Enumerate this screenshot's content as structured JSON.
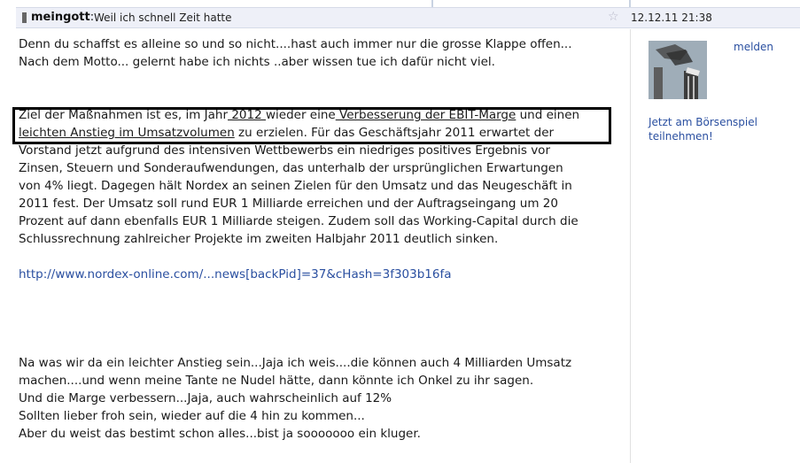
{
  "post": {
    "author": "meingott",
    "subject_sep": ":",
    "subject": "Weil ich schnell Zeit hatte",
    "timestamp": "12.12.11 21:38",
    "lines_intro": [
      "Denn du schaffst es alleine so und so nicht....hast auch immer nur die grosse Klappe offen...",
      "Nach dem Motto... gelernt habe ich nichts ..aber wissen tue ich dafür nicht viel."
    ],
    "quote": {
      "l1_a": "Ziel der Maßnahmen ist es, im Jahr",
      "l1_b": " 2012 ",
      "l1_c": "wieder eine",
      "l1_d": " Verbesserung der EBIT-Marge",
      "l1_e": " und einen",
      "l2_a": "leichten Anstieg im Umsatzvolumen",
      "l2_b": " zu erzielen. Für das Geschäftsjahr 2011 erwartet der",
      "rest": [
        "Vorstand jetzt aufgrund des intensiven Wettbewerbs ein niedriges positives Ergebnis vor",
        "Zinsen, Steuern und Sonderaufwendungen, das unterhalb der ursprünglichen Erwartungen",
        "von 4% liegt. Dagegen hält Nordex an seinen Zielen für den Umsatz und das Neugeschäft in",
        "2011 fest. Der Umsatz soll rund EUR 1 Milliarde erreichen und der Auftragseingang um 20",
        "Prozent auf dann ebenfalls EUR 1 Milliarde steigen. Zudem soll das Working-Capital durch die",
        "Schlussrechnung zahlreicher Projekte im zweiten Halbjahr 2011 deutlich sinken."
      ]
    },
    "link": "http://www.nordex-online.com/...news[backPid]=37&cHash=3f303b16fa",
    "lines_outro": [
      "Na was wir da ein leichter Anstieg sein...Jaja ich weis....die können auch 4 Milliarden Umsatz",
      "machen....und wenn meine Tante ne Nudel hätte, dann könnte ich Onkel  zu ihr sagen.",
      "Und die Marge verbessern...Jaja, auch wahrscheinlich auf 12%",
      "Sollten lieber froh sein, wieder auf die 4 hin zu kommen...",
      "Aber du weist das bestimt schon alles...bist ja sooooooo ein kluger."
    ]
  },
  "sidebar": {
    "report_label": "melden",
    "game_link": "Jetzt am Börsenspiel teilnehmen!"
  },
  "colors": {
    "header_bg": "#eef0f8",
    "link": "#2a4fa0",
    "highlight_border": "#000000"
  },
  "icons": {
    "user": "user-icon",
    "star": "star-icon"
  }
}
